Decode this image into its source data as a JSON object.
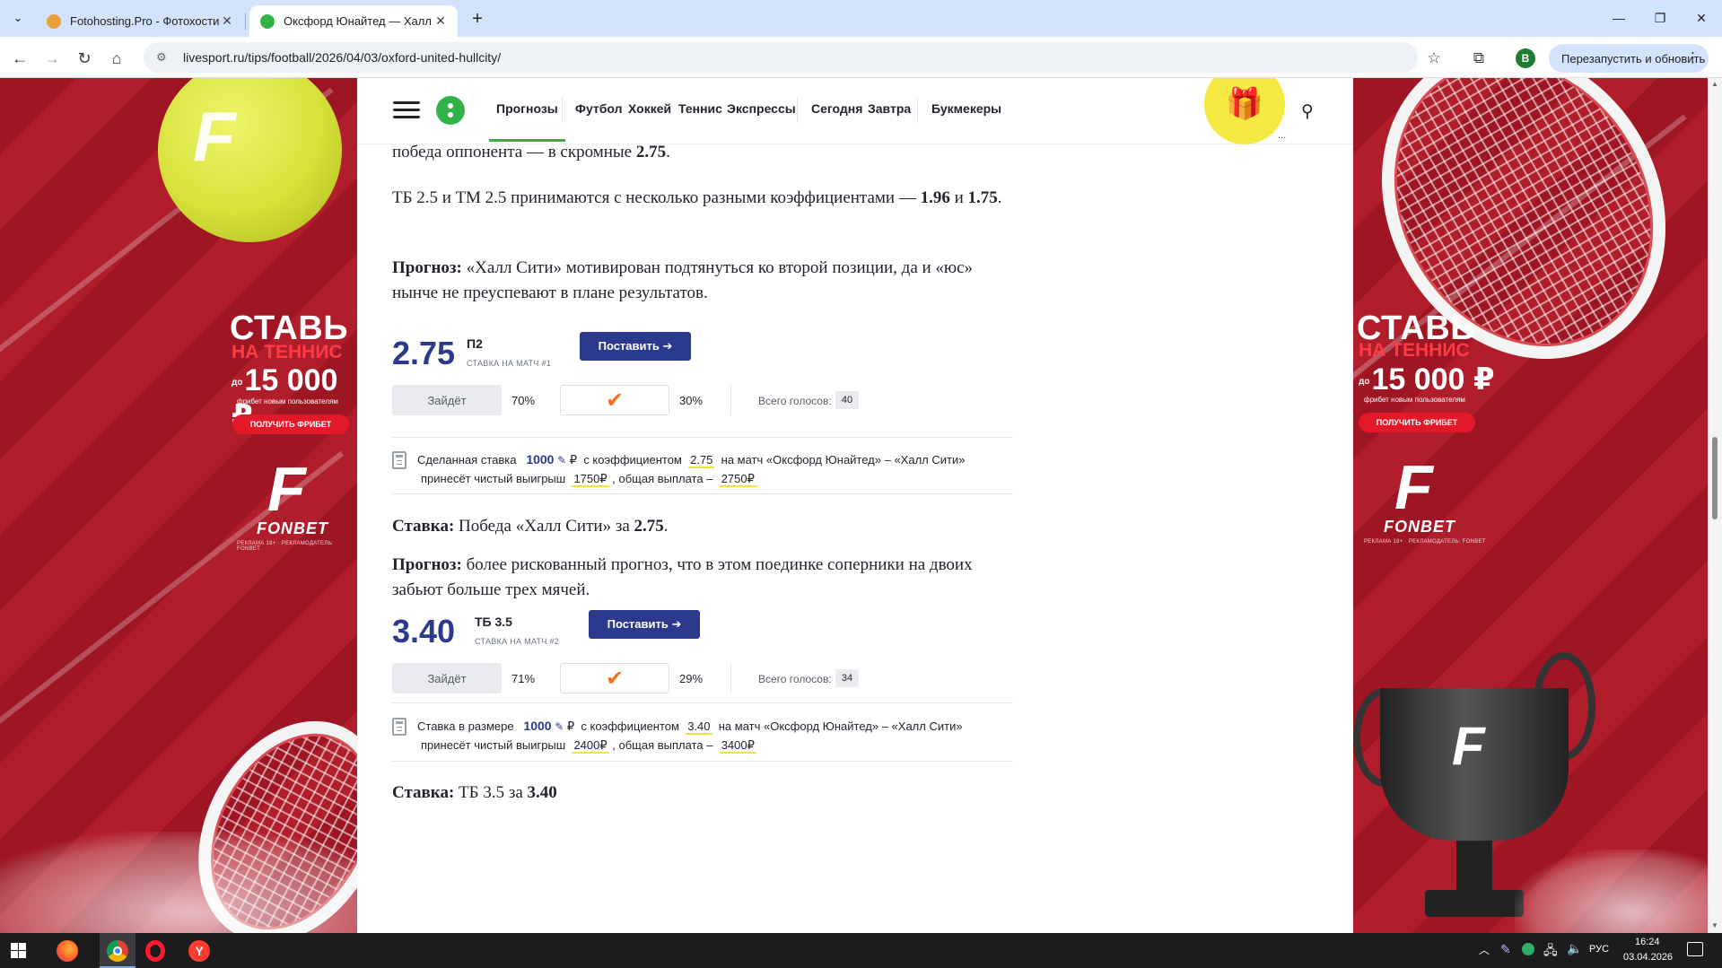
{
  "browser": {
    "tabs": [
      {
        "title": "Fotohosting.Pro - Фотохостинг",
        "active": false
      },
      {
        "title": "Оксфорд Юнайтед — Халл Сити",
        "active": true
      }
    ],
    "url": "livesport.ru/tips/football/2026/04/03/oxford-united-hullcity/",
    "profile_initial": "В",
    "relaunch_label": "Перезапустить и обновить"
  },
  "site": {
    "nav": [
      "Прогнозы",
      "Футбол",
      "Хоккей",
      "Теннис",
      "Экспрессы",
      "Сегодня",
      "Завтра",
      "Букмекеры"
    ],
    "gift_more": "..."
  },
  "ads": {
    "slogan_1": "СТАВЬ",
    "slogan_2": "НА ТЕННИС",
    "amount_prefix": "до",
    "amount": "15 000 ₽",
    "amount_caption": "фрибет новым пользователям",
    "cta": "ПОЛУЧИТЬ ФРИБЕТ",
    "brand": "FONBET",
    "brand_letter": "F",
    "legal": "РЕКЛАМА 18+ · РЕКЛАМОДАТЕЛЬ: FONBET"
  },
  "article": {
    "p1": {
      "text": "победа оппонента — в скромные ",
      "bold": "2.75",
      "tail": "."
    },
    "p2": {
      "text": "ТБ 2.5 и ТМ 2.5 принимаются с несколько разными коэффициентами — ",
      "bold1": "1.96",
      "mid": " и ",
      "bold2": "1.75",
      "tail": "."
    },
    "p3": {
      "label": "Прогноз:",
      "text": " «Халл Сити» мотивирован подтянуться ко второй позиции, да и «юс» нынче не преуспевают в плане результатов."
    },
    "pick1": {
      "odd": "2.75",
      "market": "П2",
      "sub": "СТАВКА НА МАТЧ #1",
      "button": "Поставить ➔",
      "vote_pass": "Зайдёт",
      "pass_pct": "70%",
      "fail_pct": "30%",
      "total_label": "Всего голосов:",
      "total": "40"
    },
    "calc1": {
      "pre": "Сделанная ставка",
      "stake": "1000",
      "currency": "₽",
      "coef_label": "с коэффициентом",
      "coef": "2.75",
      "match": "на матч «Оксфорд Юнайтед» – «Халл Сити»",
      "win_label": "принесёт чистый выигрыш",
      "win": "1750₽",
      "payout_label": ", общая выплата –",
      "payout": "2750₽"
    },
    "p4": {
      "label": "Ставка:",
      "text": " Победа «Халл Сити» за ",
      "bold": "2.75",
      "tail": "."
    },
    "p5": {
      "label": "Прогноз:",
      "text": " более рискованный прогноз, что в этом поединке соперники на двоих забьют больше трех мячей."
    },
    "pick2": {
      "odd": "3.40",
      "market": "ТБ 3.5",
      "sub": "СТАВКА НА МАТЧ #2",
      "button": "Поставить ➔",
      "vote_pass": "Зайдёт",
      "pass_pct": "71%",
      "fail_pct": "29%",
      "total_label": "Всего голосов:",
      "total": "34"
    },
    "calc2": {
      "pre": "Ставка в размере",
      "stake": "1000",
      "currency": "₽",
      "coef_label": "с коэффициентом",
      "coef": "3.40",
      "match": "на матч «Оксфорд Юнайтед» – «Халл Сити»",
      "win_label": "принесёт чистый выигрыш",
      "win": "2400₽",
      "payout_label": ", общая выплата –",
      "payout": "3400₽"
    },
    "p6": {
      "label": "Ставка:",
      "text": " ТБ 3.5 за ",
      "bold": "3.40"
    }
  },
  "taskbar": {
    "lang": "РУС",
    "time": "16:24",
    "date": "03.04.2026"
  },
  "colors": {
    "accent_blue": "#2b3a8c",
    "brand_green": "#33b24a",
    "gift_yellow": "#f4ea43",
    "check_orange": "#f2741f",
    "ad_red": "#9e1524"
  },
  "icons": [
    "tab-list-icon",
    "close-icon",
    "new-tab-icon",
    "back-icon",
    "forward-icon",
    "reload-icon",
    "home-icon",
    "site-info-icon",
    "star-icon",
    "extensions-icon",
    "burger-menu-icon",
    "gift-icon",
    "search-icon",
    "check-icon",
    "calculator-icon",
    "edit-icon",
    "windows-start-icon"
  ]
}
